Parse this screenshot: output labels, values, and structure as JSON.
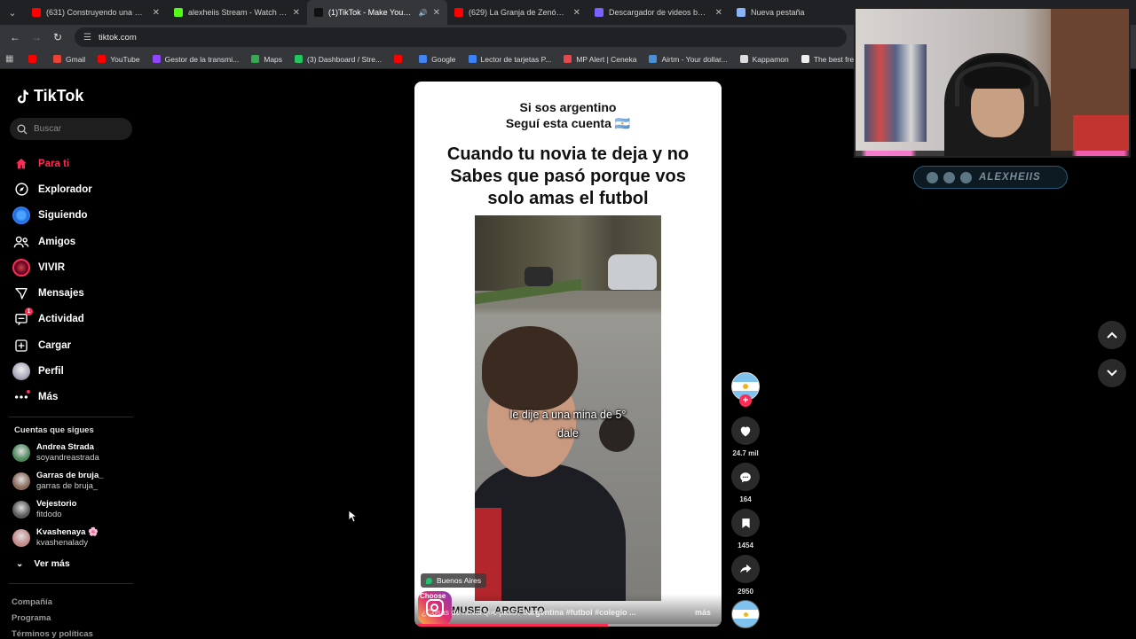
{
  "browser": {
    "tabs": [
      {
        "title": "(631) Construyendo una menta",
        "favicon_color": "#ff0000",
        "active": false
      },
      {
        "title": "alexheiis Stream - Watch Live o",
        "favicon_color": "#53fc18",
        "active": false
      },
      {
        "title": "(1)TikTok - Make Your Day",
        "favicon_color": "#111111",
        "active": true
      },
      {
        "title": "(629) La Granja de Zenón - Las",
        "favicon_color": "#ff0000",
        "active": false
      },
      {
        "title": "Descargador de videos bajo de",
        "favicon_color": "#7b61ff",
        "active": false
      },
      {
        "title": "Nueva pestaña",
        "favicon_color": "#8ab4f8",
        "active": false
      }
    ],
    "url": "tiktok.com",
    "bookmarks": [
      {
        "label": "",
        "color": "#ff0000"
      },
      {
        "label": "Gmail",
        "color": "#ea4335"
      },
      {
        "label": "YouTube",
        "color": "#ff0000"
      },
      {
        "label": "Gestor de la transmi...",
        "color": "#9146ff"
      },
      {
        "label": "Maps",
        "color": "#34a853"
      },
      {
        "label": "(3) Dashboard / Stre...",
        "color": "#22c55e"
      },
      {
        "label": "",
        "color": "#ff0000"
      },
      {
        "label": "Google",
        "color": "#4285f4"
      },
      {
        "label": "Lector de tarjetas P...",
        "color": "#3b82f6"
      },
      {
        "label": "MP Alert | Ceneka",
        "color": "#e5484d"
      },
      {
        "label": "Airtm - Your dollar...",
        "color": "#4a90d9"
      },
      {
        "label": "Kappamon",
        "color": "#dddddd"
      },
      {
        "label": "The best free softwa...",
        "color": "#eeeeee"
      }
    ]
  },
  "tiktok": {
    "logo": "TikTok",
    "search_placeholder": "Buscar",
    "menu": [
      {
        "label": "Para ti",
        "icon": "home-icon",
        "active": true
      },
      {
        "label": "Explorador",
        "icon": "compass-icon",
        "active": false
      },
      {
        "label": "Siguiendo",
        "icon": "following-avatar-icon",
        "active": false
      },
      {
        "label": "Amigos",
        "icon": "friends-icon",
        "active": false
      },
      {
        "label": "VIVIR",
        "icon": "live-icon",
        "active": false
      },
      {
        "label": "Mensajes",
        "icon": "messages-icon",
        "active": false
      },
      {
        "label": "Actividad",
        "icon": "activity-icon",
        "active": false,
        "badge": "1"
      },
      {
        "label": "Cargar",
        "icon": "upload-icon",
        "active": false
      },
      {
        "label": "Perfil",
        "icon": "profile-icon",
        "active": false
      },
      {
        "label": "Más",
        "icon": "more-icon",
        "active": false
      }
    ],
    "following_title": "Cuentas que sigues",
    "accounts": [
      {
        "name": "Andrea Strada",
        "user": "soyandreastrada",
        "color": "#4f8a5c"
      },
      {
        "name": "Garras de bruja_",
        "user": "garras de bruja_",
        "color": "#8a6a5a"
      },
      {
        "name": "Vejestorio",
        "user": "fitdodo",
        "color": "#5a5a5a"
      },
      {
        "name": "Kvashenaya 🌸",
        "user": "kvashenalady",
        "color": "#c48a8a"
      }
    ],
    "ver_mas": "Ver más",
    "footer": [
      "Compañía",
      "Programa",
      "Términos y políticas"
    ]
  },
  "video": {
    "header_line1": "Si sos argentino",
    "header_line2": "Seguí esta cuenta 🇦🇷",
    "title_line1": "Cuando tu novia te deja y no",
    "title_line2": "Sabes que pasó porque vos",
    "title_line3": "solo amas el futbol",
    "caption_line1": "le dije a una mina de 5°",
    "caption_line2": "dale",
    "location": "Buenos Aires",
    "choose_text": "Choose",
    "account_overlay": "MUSEO_ARGENTO",
    "description": "¿Cosas de novia que pasó?",
    "tags": "#argentina #futbol #colegio ...",
    "more": "más",
    "progress": 0.63
  },
  "actions": {
    "likes": "24.7 mil",
    "comments": "164",
    "saves": "1454",
    "shares": "2950"
  },
  "stream": {
    "channel": "ALEXHEIIS"
  }
}
